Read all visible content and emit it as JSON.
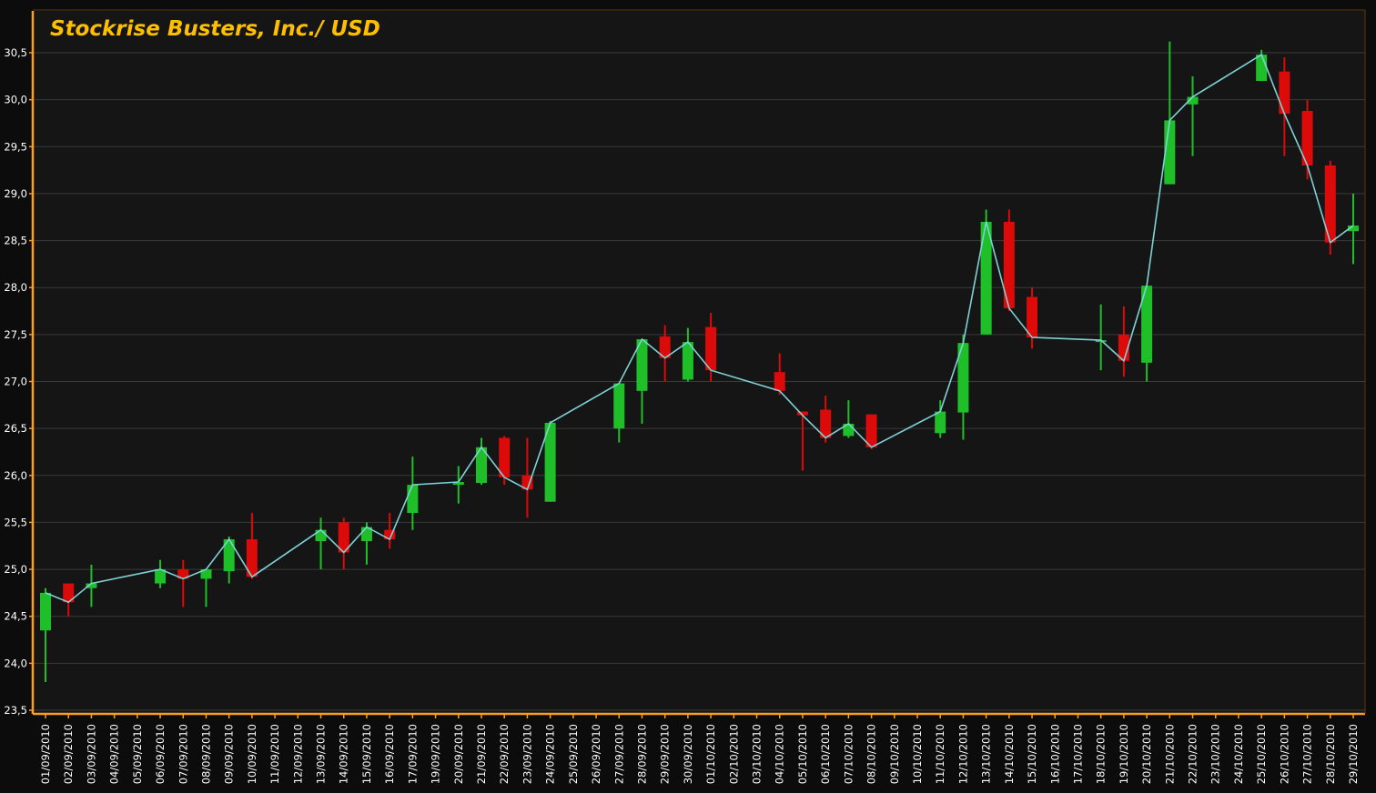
{
  "chart_data": {
    "type": "candlestick",
    "title": "Stockrise Busters, Inc./ USD",
    "xlabel": "",
    "ylabel": "",
    "ylim": [
      23.5,
      30.5
    ],
    "y_ticks": [
      "23,5",
      "24,0",
      "24,5",
      "25,0",
      "25,5",
      "26,0",
      "26,5",
      "27,0",
      "27,5",
      "28,0",
      "28,5",
      "29,0",
      "29,5",
      "30,0",
      "30,5"
    ],
    "grid": true,
    "colors": {
      "background": "#151515",
      "grid": "#3a3a3a",
      "axis": "#ff9d1e",
      "title": "#ffbf00",
      "up": "#1fbf2a",
      "down": "#dd0a0a",
      "line": "#7fd1d6",
      "text": "#ffffff"
    },
    "categories": [
      "01/09/2010",
      "02/09/2010",
      "03/09/2010",
      "04/09/2010",
      "05/09/2010",
      "06/09/2010",
      "07/09/2010",
      "08/09/2010",
      "09/09/2010",
      "10/09/2010",
      "11/09/2010",
      "12/09/2010",
      "13/09/2010",
      "14/09/2010",
      "15/09/2010",
      "16/09/2010",
      "17/09/2010",
      "19/09/2010",
      "20/09/2010",
      "21/09/2010",
      "22/09/2010",
      "23/09/2010",
      "24/09/2010",
      "25/09/2010",
      "26/09/2010",
      "27/09/2010",
      "28/09/2010",
      "29/09/2010",
      "30/09/2010",
      "01/10/2010",
      "02/10/2010",
      "03/10/2010",
      "04/10/2010",
      "05/10/2010",
      "06/10/2010",
      "07/10/2010",
      "08/10/2010",
      "09/10/2010",
      "10/10/2010",
      "11/10/2010",
      "12/10/2010",
      "13/10/2010",
      "14/10/2010",
      "15/10/2010",
      "16/10/2010",
      "17/10/2010",
      "18/10/2010",
      "19/10/2010",
      "20/10/2010",
      "21/10/2010",
      "22/10/2010",
      "23/10/2010",
      "24/10/2010",
      "25/10/2010",
      "26/10/2010",
      "27/10/2010",
      "28/10/2010",
      "29/10/2010"
    ],
    "series": [
      {
        "type": "candlestick",
        "values": [
          {
            "x": "01/09/2010",
            "open": 24.35,
            "high": 24.8,
            "low": 23.8,
            "close": 24.75
          },
          {
            "x": "02/09/2010",
            "open": 24.85,
            "high": 24.85,
            "low": 24.5,
            "close": 24.65
          },
          {
            "x": "03/09/2010",
            "open": 24.8,
            "high": 25.05,
            "low": 24.6,
            "close": 24.85
          },
          {
            "x": "06/09/2010",
            "open": 24.85,
            "high": 25.1,
            "low": 24.8,
            "close": 25.0
          },
          {
            "x": "07/09/2010",
            "open": 25.0,
            "high": 25.1,
            "low": 24.6,
            "close": 24.9
          },
          {
            "x": "08/09/2010",
            "open": 24.9,
            "high": 25.0,
            "low": 24.6,
            "close": 25.0
          },
          {
            "x": "09/09/2010",
            "open": 24.98,
            "high": 25.35,
            "low": 24.85,
            "close": 25.32
          },
          {
            "x": "10/09/2010",
            "open": 25.32,
            "high": 25.6,
            "low": 24.9,
            "close": 24.92
          },
          {
            "x": "13/09/2010",
            "open": 25.3,
            "high": 25.55,
            "low": 25.0,
            "close": 25.42
          },
          {
            "x": "14/09/2010",
            "open": 25.5,
            "high": 25.55,
            "low": 25.0,
            "close": 25.18
          },
          {
            "x": "15/09/2010",
            "open": 25.3,
            "high": 25.5,
            "low": 25.05,
            "close": 25.45
          },
          {
            "x": "16/09/2010",
            "open": 25.42,
            "high": 25.6,
            "low": 25.22,
            "close": 25.32
          },
          {
            "x": "17/09/2010",
            "open": 25.6,
            "high": 26.2,
            "low": 25.42,
            "close": 25.9
          },
          {
            "x": "20/09/2010",
            "open": 25.9,
            "high": 26.1,
            "low": 25.7,
            "close": 25.93
          },
          {
            "x": "21/09/2010",
            "open": 25.92,
            "high": 26.4,
            "low": 25.9,
            "close": 26.3
          },
          {
            "x": "22/09/2010",
            "open": 26.4,
            "high": 26.42,
            "low": 25.9,
            "close": 25.98
          },
          {
            "x": "23/09/2010",
            "open": 26.0,
            "high": 26.4,
            "low": 25.55,
            "close": 25.85
          },
          {
            "x": "24/09/2010",
            "open": 25.72,
            "high": 26.58,
            "low": 25.72,
            "close": 26.56
          },
          {
            "x": "27/09/2010",
            "open": 26.5,
            "high": 26.98,
            "low": 26.35,
            "close": 26.98
          },
          {
            "x": "28/09/2010",
            "open": 26.9,
            "high": 27.45,
            "low": 26.55,
            "close": 27.45
          },
          {
            "x": "29/09/2010",
            "open": 27.48,
            "high": 27.6,
            "low": 27.0,
            "close": 27.25
          },
          {
            "x": "30/09/2010",
            "open": 27.02,
            "high": 27.57,
            "low": 27.0,
            "close": 27.42
          },
          {
            "x": "01/10/2010",
            "open": 27.58,
            "high": 27.73,
            "low": 27.0,
            "close": 27.12
          },
          {
            "x": "04/10/2010",
            "open": 27.1,
            "high": 27.3,
            "low": 26.86,
            "close": 26.9
          },
          {
            "x": "05/10/2010",
            "open": 26.68,
            "high": 26.68,
            "low": 26.05,
            "close": 26.64
          },
          {
            "x": "06/10/2010",
            "open": 26.7,
            "high": 26.85,
            "low": 26.35,
            "close": 26.4
          },
          {
            "x": "07/10/2010",
            "open": 26.42,
            "high": 26.8,
            "low": 26.4,
            "close": 26.55
          },
          {
            "x": "08/10/2010",
            "open": 26.65,
            "high": 26.65,
            "low": 26.28,
            "close": 26.3
          },
          {
            "x": "11/10/2010",
            "open": 26.45,
            "high": 26.8,
            "low": 26.4,
            "close": 26.68
          },
          {
            "x": "12/10/2010",
            "open": 26.67,
            "high": 27.5,
            "low": 26.38,
            "close": 27.41
          },
          {
            "x": "13/10/2010",
            "open": 27.5,
            "high": 28.83,
            "low": 27.5,
            "close": 28.7
          },
          {
            "x": "14/10/2010",
            "open": 28.7,
            "high": 28.83,
            "low": 27.75,
            "close": 27.78
          },
          {
            "x": "15/10/2010",
            "open": 27.9,
            "high": 28.0,
            "low": 27.35,
            "close": 27.47
          },
          {
            "x": "18/10/2010",
            "open": 27.42,
            "high": 27.82,
            "low": 27.12,
            "close": 27.44
          },
          {
            "x": "19/10/2010",
            "open": 27.5,
            "high": 27.8,
            "low": 27.05,
            "close": 27.22
          },
          {
            "x": "20/10/2010",
            "open": 27.2,
            "high": 28.02,
            "low": 27.0,
            "close": 28.02
          },
          {
            "x": "21/10/2010",
            "open": 29.1,
            "high": 30.62,
            "low": 29.1,
            "close": 29.78
          },
          {
            "x": "22/10/2010",
            "open": 29.95,
            "high": 30.25,
            "low": 29.4,
            "close": 30.03
          },
          {
            "x": "25/10/2010",
            "open": 30.2,
            "high": 30.53,
            "low": 30.2,
            "close": 30.48
          },
          {
            "x": "26/10/2010",
            "open": 30.3,
            "high": 30.45,
            "low": 29.4,
            "close": 29.85
          },
          {
            "x": "27/10/2010",
            "open": 29.88,
            "high": 30.0,
            "low": 29.15,
            "close": 29.3
          },
          {
            "x": "28/10/2010",
            "open": 29.3,
            "high": 29.35,
            "low": 28.35,
            "close": 28.48
          },
          {
            "x": "29/10/2010",
            "open": 28.6,
            "high": 29.0,
            "low": 28.25,
            "close": 28.66
          }
        ]
      }
    ]
  }
}
